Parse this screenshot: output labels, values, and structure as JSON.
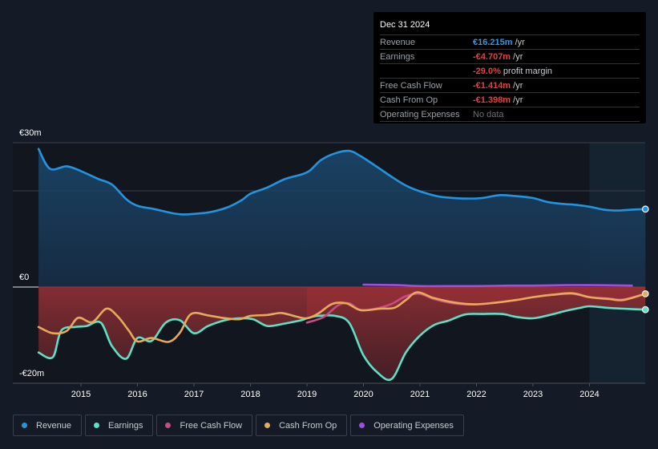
{
  "tooltip": {
    "date": "Dec 31 2024",
    "rows": [
      {
        "label": "Revenue",
        "value": "€16.215m",
        "unit": " /yr",
        "tone": "pos"
      },
      {
        "label": "Earnings",
        "value": "-€4.707m",
        "unit": " /yr",
        "tone": "neg"
      },
      {
        "label": "",
        "value": "-29.0%",
        "unit": " profit margin",
        "tone": "neg"
      },
      {
        "label": "Free Cash Flow",
        "value": "-€1.414m",
        "unit": " /yr",
        "tone": "neg"
      },
      {
        "label": "Cash From Op",
        "value": "-€1.398m",
        "unit": " /yr",
        "tone": "neg"
      },
      {
        "label": "Operating Expenses",
        "value": "No data",
        "unit": "",
        "tone": "nodata"
      }
    ]
  },
  "legend": [
    {
      "label": "Revenue",
      "color": "#2394df"
    },
    {
      "label": "Earnings",
      "color": "#5ce0c6"
    },
    {
      "label": "Free Cash Flow",
      "color": "#c84b86"
    },
    {
      "label": "Cash From Op",
      "color": "#e9a95a"
    },
    {
      "label": "Operating Expenses",
      "color": "#a04ee0"
    }
  ],
  "chart_data": {
    "type": "line",
    "title": "",
    "xlabel": "",
    "ylabel": "",
    "currency": "EUR",
    "y_unit": "m",
    "ylim": [
      -20,
      30
    ],
    "xlim": [
      2013.55,
      2025.0
    ],
    "y_tick_labels": [
      {
        "value": 30,
        "label": "€30m"
      },
      {
        "value": 0,
        "label": "€0"
      },
      {
        "value": -20,
        "label": "-€20m"
      }
    ],
    "x_tick_labels": [
      "2015",
      "2016",
      "2017",
      "2018",
      "2019",
      "2020",
      "2021",
      "2022",
      "2023",
      "2024"
    ],
    "x_ticks": [
      2015,
      2016,
      2017,
      2018,
      2019,
      2020,
      2021,
      2022,
      2023,
      2024
    ],
    "gridlines": [
      30,
      20,
      0
    ],
    "highlight_region_start": 2024.0,
    "series": [
      {
        "name": "Revenue",
        "color": "#2394df",
        "points": [
          [
            2014.25,
            28.7
          ],
          [
            2014.45,
            24.6
          ],
          [
            2014.75,
            25.1
          ],
          [
            2015.0,
            24.1
          ],
          [
            2015.3,
            22.5
          ],
          [
            2015.55,
            21.3
          ],
          [
            2015.8,
            18.3
          ],
          [
            2016.0,
            16.9
          ],
          [
            2016.3,
            16.2
          ],
          [
            2016.6,
            15.4
          ],
          [
            2016.8,
            15.1
          ],
          [
            2017.0,
            15.2
          ],
          [
            2017.3,
            15.6
          ],
          [
            2017.6,
            16.6
          ],
          [
            2017.85,
            18.1
          ],
          [
            2018.0,
            19.4
          ],
          [
            2018.3,
            20.7
          ],
          [
            2018.6,
            22.4
          ],
          [
            2018.9,
            23.4
          ],
          [
            2019.05,
            24.2
          ],
          [
            2019.25,
            26.4
          ],
          [
            2019.5,
            27.8
          ],
          [
            2019.75,
            28.3
          ],
          [
            2019.95,
            27.2
          ],
          [
            2020.25,
            24.9
          ],
          [
            2020.5,
            22.9
          ],
          [
            2020.75,
            21.1
          ],
          [
            2021.0,
            19.9
          ],
          [
            2021.3,
            18.9
          ],
          [
            2021.5,
            18.6
          ],
          [
            2021.8,
            18.4
          ],
          [
            2022.1,
            18.5
          ],
          [
            2022.4,
            19.1
          ],
          [
            2022.7,
            18.9
          ],
          [
            2023.0,
            18.5
          ],
          [
            2023.25,
            17.7
          ],
          [
            2023.5,
            17.3
          ],
          [
            2023.75,
            17.1
          ],
          [
            2024.0,
            16.7
          ],
          [
            2024.25,
            16.1
          ],
          [
            2024.5,
            15.9
          ],
          [
            2024.75,
            16.1
          ],
          [
            2024.99,
            16.2
          ]
        ]
      },
      {
        "name": "Earnings",
        "color": "#5ce0c6",
        "points": [
          [
            2014.25,
            -13.6
          ],
          [
            2014.5,
            -14.6
          ],
          [
            2014.65,
            -9.1
          ],
          [
            2014.9,
            -8.3
          ],
          [
            2015.1,
            -8.1
          ],
          [
            2015.35,
            -7.4
          ],
          [
            2015.55,
            -12.3
          ],
          [
            2015.8,
            -14.9
          ],
          [
            2016.0,
            -10.6
          ],
          [
            2016.25,
            -11.2
          ],
          [
            2016.5,
            -7.4
          ],
          [
            2016.75,
            -6.9
          ],
          [
            2017.0,
            -9.6
          ],
          [
            2017.25,
            -8.1
          ],
          [
            2017.55,
            -6.9
          ],
          [
            2017.8,
            -6.5
          ],
          [
            2018.05,
            -6.7
          ],
          [
            2018.3,
            -8.1
          ],
          [
            2018.6,
            -7.6
          ],
          [
            2018.9,
            -6.9
          ],
          [
            2019.0,
            -6.5
          ],
          [
            2019.2,
            -6.0
          ],
          [
            2019.5,
            -6.0
          ],
          [
            2019.75,
            -7.5
          ],
          [
            2020.0,
            -14.2
          ],
          [
            2020.25,
            -17.8
          ],
          [
            2020.5,
            -19.1
          ],
          [
            2020.75,
            -13.6
          ],
          [
            2021.0,
            -10.1
          ],
          [
            2021.25,
            -7.9
          ],
          [
            2021.5,
            -7.0
          ],
          [
            2021.8,
            -5.7
          ],
          [
            2022.1,
            -5.6
          ],
          [
            2022.45,
            -5.6
          ],
          [
            2022.7,
            -6.2
          ],
          [
            2023.0,
            -6.5
          ],
          [
            2023.3,
            -5.8
          ],
          [
            2023.6,
            -4.9
          ],
          [
            2023.85,
            -4.3
          ],
          [
            2024.0,
            -4.0
          ],
          [
            2024.3,
            -4.3
          ],
          [
            2024.6,
            -4.5
          ],
          [
            2024.99,
            -4.7
          ]
        ]
      },
      {
        "name": "Free Cash Flow",
        "color": "#c84b86",
        "points": [
          [
            2019.0,
            -7.4
          ],
          [
            2019.3,
            -6.2
          ],
          [
            2019.55,
            -3.8
          ],
          [
            2019.75,
            -3.4
          ],
          [
            2019.95,
            -4.8
          ],
          [
            2020.25,
            -4.4
          ],
          [
            2020.5,
            -3.5
          ],
          [
            2020.75,
            -1.9
          ],
          [
            2021.0,
            -1.4
          ],
          [
            2021.25,
            -2.5
          ],
          [
            2021.6,
            -3.4
          ],
          [
            2021.95,
            -3.6
          ],
          [
            2022.3,
            -3.3
          ],
          [
            2022.7,
            -2.7
          ],
          [
            2023.0,
            -2.1
          ],
          [
            2023.35,
            -1.6
          ],
          [
            2023.7,
            -1.4
          ],
          [
            2024.0,
            -2.1
          ],
          [
            2024.35,
            -2.4
          ],
          [
            2024.6,
            -2.6
          ],
          [
            2024.99,
            -1.4
          ]
        ]
      },
      {
        "name": "Cash From Op",
        "color": "#e9a95a",
        "points": [
          [
            2014.25,
            -8.3
          ],
          [
            2014.5,
            -9.6
          ],
          [
            2014.75,
            -9.1
          ],
          [
            2014.95,
            -6.4
          ],
          [
            2015.2,
            -7.3
          ],
          [
            2015.45,
            -4.5
          ],
          [
            2015.65,
            -6.1
          ],
          [
            2015.85,
            -9.1
          ],
          [
            2016.0,
            -11.3
          ],
          [
            2016.25,
            -10.6
          ],
          [
            2016.55,
            -11.4
          ],
          [
            2016.75,
            -9.5
          ],
          [
            2016.95,
            -5.6
          ],
          [
            2017.25,
            -5.9
          ],
          [
            2017.5,
            -6.4
          ],
          [
            2017.8,
            -6.7
          ],
          [
            2018.0,
            -6.0
          ],
          [
            2018.3,
            -5.8
          ],
          [
            2018.55,
            -5.4
          ],
          [
            2018.8,
            -6.1
          ],
          [
            2019.0,
            -6.5
          ],
          [
            2019.2,
            -5.5
          ],
          [
            2019.45,
            -3.5
          ],
          [
            2019.7,
            -3.4
          ],
          [
            2019.95,
            -4.8
          ],
          [
            2020.3,
            -4.5
          ],
          [
            2020.55,
            -4.3
          ],
          [
            2020.75,
            -2.7
          ],
          [
            2020.95,
            -1.1
          ],
          [
            2021.25,
            -2.3
          ],
          [
            2021.6,
            -3.2
          ],
          [
            2021.95,
            -3.6
          ],
          [
            2022.3,
            -3.3
          ],
          [
            2022.7,
            -2.7
          ],
          [
            2023.0,
            -2.1
          ],
          [
            2023.35,
            -1.6
          ],
          [
            2023.7,
            -1.3
          ],
          [
            2024.0,
            -2.1
          ],
          [
            2024.35,
            -2.5
          ],
          [
            2024.6,
            -2.7
          ],
          [
            2024.99,
            -1.4
          ]
        ]
      },
      {
        "name": "Operating Expenses",
        "color": "#a04ee0",
        "points": [
          [
            2020.0,
            0.5
          ],
          [
            2020.6,
            0.4
          ],
          [
            2021.0,
            0.2
          ],
          [
            2021.6,
            0.2
          ],
          [
            2022.0,
            0.2
          ],
          [
            2022.6,
            0.3
          ],
          [
            2023.0,
            0.3
          ],
          [
            2023.6,
            0.4
          ],
          [
            2024.0,
            0.4
          ],
          [
            2024.5,
            0.35
          ],
          [
            2024.75,
            0.3
          ]
        ]
      }
    ]
  }
}
